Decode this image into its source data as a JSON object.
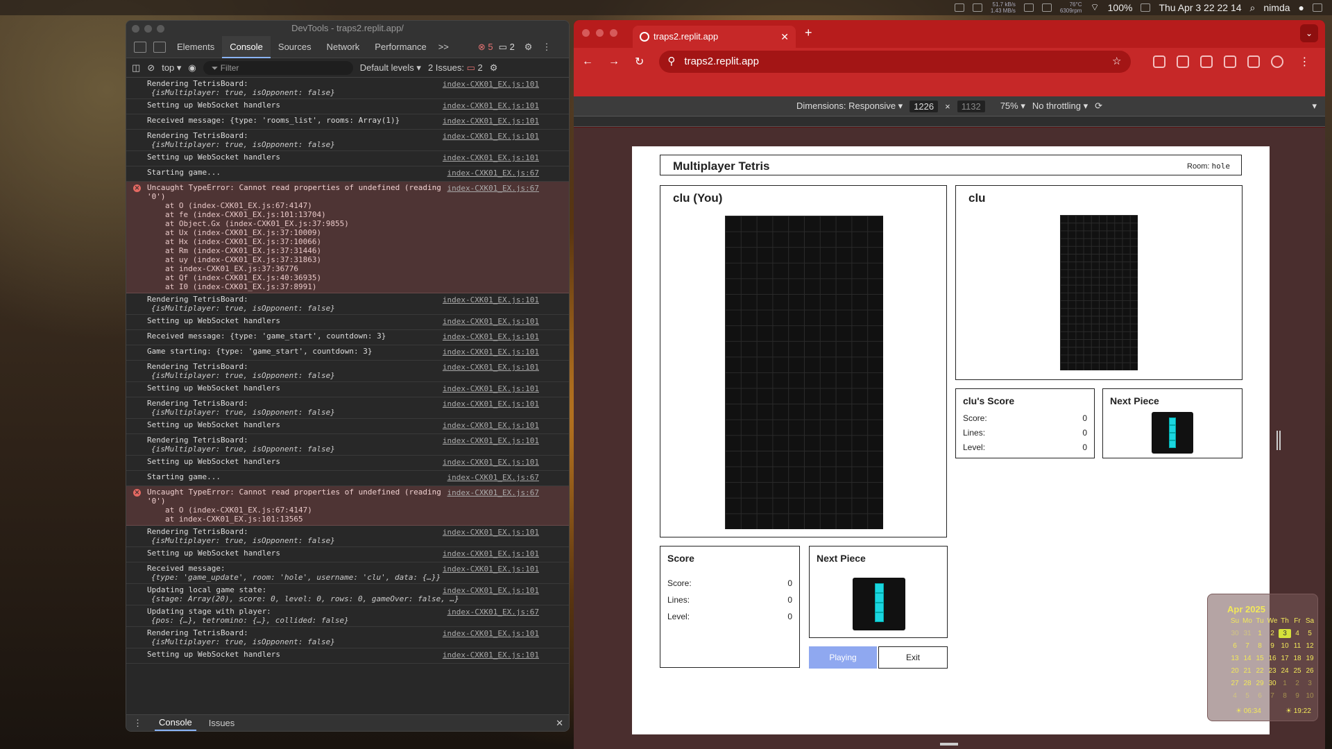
{
  "menubar": {
    "net_up": "51.7 kB/s",
    "net_down": "1.43 MB/s",
    "weather_temp": "76°C",
    "weather_sub": "6309rpm",
    "battery": "100%",
    "datetime": "Thu Apr 3  22 22 14",
    "user": "nimda"
  },
  "devtools": {
    "title": "DevTools - traps2.replit.app/",
    "tabs": [
      "Elements",
      "Console",
      "Sources",
      "Network",
      "Performance"
    ],
    "more_tabs": ">>",
    "error_count": "5",
    "warn_count": "2",
    "context": "top",
    "filter_placeholder": "Filter",
    "levels": "Default levels",
    "issues": "2 Issues:",
    "issues_count": "2",
    "drawer_tabs": [
      "Console",
      "Issues"
    ],
    "rows": [
      {
        "type": "log",
        "text": "Rendering TetrisBoard:",
        "src": "index-CXK01_EX.js:101",
        "sub": "{isMultiplayer: true, isOpponent: false}"
      },
      {
        "type": "log",
        "text": "Setting up WebSocket handlers",
        "src": "index-CXK01_EX.js:101"
      },
      {
        "type": "log",
        "text": "Received message:  {type: 'rooms_list', rooms: Array(1)}",
        "src": "index-CXK01_EX.js:101"
      },
      {
        "type": "log",
        "text": "Rendering TetrisBoard:",
        "src": "index-CXK01_EX.js:101",
        "sub": "{isMultiplayer: true, isOpponent: false}"
      },
      {
        "type": "log",
        "text": "Setting up WebSocket handlers",
        "src": "index-CXK01_EX.js:101"
      },
      {
        "type": "log",
        "text": "Starting game...",
        "src": "index-CXK01_EX.js:67"
      },
      {
        "type": "err",
        "text": "Uncaught TypeError: Cannot read properties of undefined (reading '0')",
        "src": "index-CXK01_EX.js:67",
        "stack": [
          "at O (index-CXK01_EX.js:67:4147)",
          "at fe (index-CXK01_EX.js:101:13704)",
          "at Object.Gx (index-CXK01_EX.js:37:9855)",
          "at Ux (index-CXK01_EX.js:37:10009)",
          "at Hx (index-CXK01_EX.js:37:10066)",
          "at Rm (index-CXK01_EX.js:37:31446)",
          "at uy (index-CXK01_EX.js:37:31863)",
          "at index-CXK01_EX.js:37:36776",
          "at Qf (index-CXK01_EX.js:40:36935)",
          "at I0 (index-CXK01_EX.js:37:8991)"
        ]
      },
      {
        "type": "log",
        "text": "Rendering TetrisBoard:",
        "src": "index-CXK01_EX.js:101",
        "sub": "{isMultiplayer: true, isOpponent: false}"
      },
      {
        "type": "log",
        "text": "Setting up WebSocket handlers",
        "src": "index-CXK01_EX.js:101"
      },
      {
        "type": "log",
        "text": "Received message:  {type: 'game_start', countdown: 3}",
        "src": "index-CXK01_EX.js:101"
      },
      {
        "type": "log",
        "text": "Game starting:  {type: 'game_start', countdown: 3}",
        "src": "index-CXK01_EX.js:101"
      },
      {
        "type": "log",
        "text": "Rendering TetrisBoard:",
        "src": "index-CXK01_EX.js:101",
        "sub": "{isMultiplayer: true, isOpponent: false}"
      },
      {
        "type": "log",
        "text": "Setting up WebSocket handlers",
        "src": "index-CXK01_EX.js:101"
      },
      {
        "type": "log",
        "text": "Rendering TetrisBoard:",
        "src": "index-CXK01_EX.js:101",
        "sub": "{isMultiplayer: true, isOpponent: false}"
      },
      {
        "type": "log",
        "text": "Setting up WebSocket handlers",
        "src": "index-CXK01_EX.js:101"
      },
      {
        "type": "log",
        "text": "Rendering TetrisBoard:",
        "src": "index-CXK01_EX.js:101",
        "sub": "{isMultiplayer: true, isOpponent: false}"
      },
      {
        "type": "log",
        "text": "Setting up WebSocket handlers",
        "src": "index-CXK01_EX.js:101"
      },
      {
        "type": "log",
        "text": "Starting game...",
        "src": "index-CXK01_EX.js:67"
      },
      {
        "type": "err",
        "text": "Uncaught TypeError: Cannot read properties of undefined (reading '0')",
        "src": "index-CXK01_EX.js:67",
        "stack": [
          "at O (index-CXK01_EX.js:67:4147)",
          "at index-CXK01_EX.js:101:13565"
        ]
      },
      {
        "type": "log",
        "text": "Rendering TetrisBoard:",
        "src": "index-CXK01_EX.js:101",
        "sub": "{isMultiplayer: true, isOpponent: false}"
      },
      {
        "type": "log",
        "text": "Setting up WebSocket handlers",
        "src": "index-CXK01_EX.js:101"
      },
      {
        "type": "log",
        "text": "Received message:",
        "src": "index-CXK01_EX.js:101",
        "sub": "{type: 'game_update', room: 'hole', username: 'clu', data: {…}}"
      },
      {
        "type": "log",
        "text": "Updating local game state:",
        "src": "index-CXK01_EX.js:101",
        "sub": "{stage: Array(20), score: 0, level: 0, rows: 0, gameOver: false, …}"
      },
      {
        "type": "log",
        "text": "Updating stage with player:",
        "src": "index-CXK01_EX.js:67",
        "sub": "{pos: {…}, tetromino: {…}, collided: false}"
      },
      {
        "type": "log",
        "text": "Rendering TetrisBoard:",
        "src": "index-CXK01_EX.js:101",
        "sub": "{isMultiplayer: true, isOpponent: false}"
      },
      {
        "type": "log",
        "text": "Setting up WebSocket handlers",
        "src": "index-CXK01_EX.js:101"
      }
    ]
  },
  "browser": {
    "tab_title": "traps2.replit.app",
    "url": "traps2.replit.app",
    "dims_label": "Dimensions: Responsive",
    "width": "1226",
    "height": "1132",
    "zoom": "75%",
    "throttle": "No throttling"
  },
  "app": {
    "title": "Multiplayer Tetris",
    "room_label": "Room:",
    "room": "hole",
    "you_name": "clu (You)",
    "opp_name": "clu",
    "opp_score_title": "clu's Score",
    "next_title": "Next Piece",
    "score_title": "Score",
    "score_label": "Score:",
    "lines_label": "Lines:",
    "level_label": "Level:",
    "score": "0",
    "lines": "0",
    "level": "0",
    "opp_score": "0",
    "opp_lines": "0",
    "opp_level": "0",
    "play_button": "Playing",
    "exit_button": "Exit",
    "piece_color": "#1bd6e0"
  },
  "calendar": {
    "month": "Apr 2025",
    "days": [
      "Su",
      "Mo",
      "Tu",
      "We",
      "Th",
      "Fr",
      "Sa"
    ],
    "cells": [
      "30",
      "31",
      "1",
      "2",
      "3",
      "4",
      "5",
      "6",
      "7",
      "8",
      "9",
      "10",
      "11",
      "12",
      "13",
      "14",
      "15",
      "16",
      "17",
      "18",
      "19",
      "20",
      "21",
      "22",
      "23",
      "24",
      "25",
      "26",
      "27",
      "28",
      "29",
      "30",
      "1",
      "2",
      "3",
      "4",
      "5",
      "6",
      "7",
      "8",
      "9",
      "10"
    ],
    "sunrise": "06:34",
    "sunset": "19:22"
  }
}
